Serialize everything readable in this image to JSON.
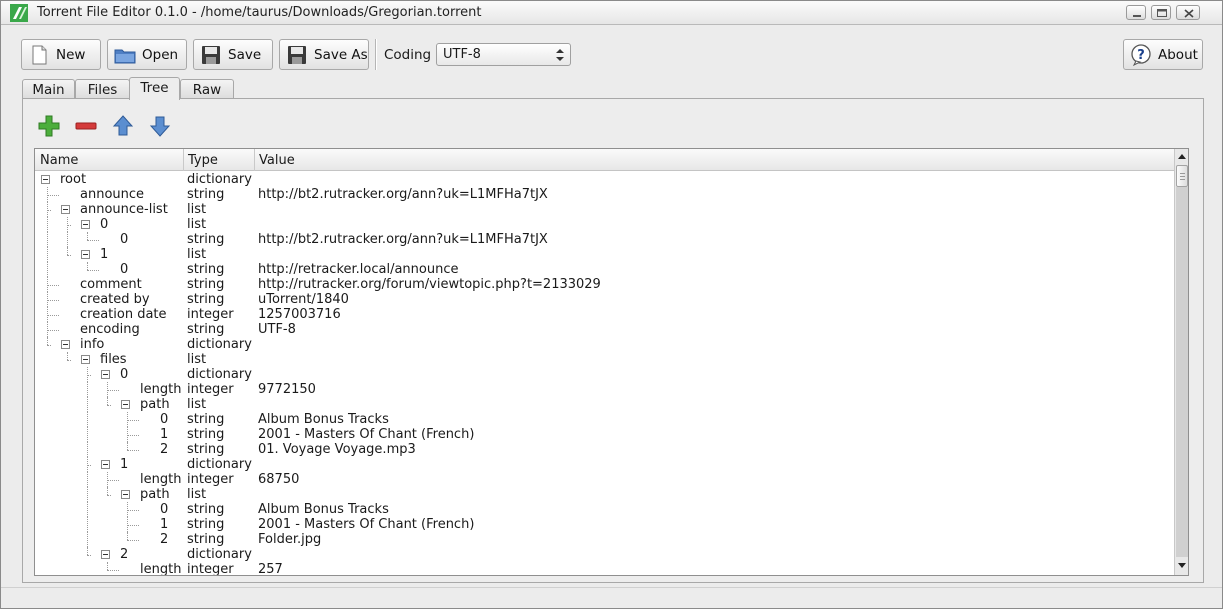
{
  "window": {
    "title": "Torrent File Editor 0.1.0 - /home/taurus/Downloads/Gregorian.torrent"
  },
  "toolbar": {
    "new_label": "New",
    "open_label": "Open",
    "save_label": "Save",
    "save_as_label": "Save As",
    "coding_label": "Coding",
    "coding_value": "UTF-8",
    "about_label": "About"
  },
  "tabs": [
    {
      "label": "Main"
    },
    {
      "label": "Files"
    },
    {
      "label": "Tree",
      "active": true
    },
    {
      "label": "Raw"
    }
  ],
  "tree_tools": [
    "add-icon",
    "remove-icon",
    "move-up-icon",
    "move-down-icon"
  ],
  "columns": [
    "Name",
    "Type",
    "Value"
  ],
  "rows": [
    {
      "depth": 0,
      "expander": true,
      "name": "root",
      "type": "dictionary",
      "value": ""
    },
    {
      "depth": 1,
      "expander": false,
      "name": "announce",
      "type": "string",
      "value": "http://bt2.rutracker.org/ann?uk=L1MFHa7tJX"
    },
    {
      "depth": 1,
      "expander": true,
      "name": "announce-list",
      "type": "list",
      "value": ""
    },
    {
      "depth": 2,
      "expander": true,
      "name": "0",
      "type": "list",
      "value": ""
    },
    {
      "depth": 3,
      "expander": false,
      "name": "0",
      "type": "string",
      "value": "http://bt2.rutracker.org/ann?uk=L1MFHa7tJX"
    },
    {
      "depth": 2,
      "expander": true,
      "name": "1",
      "type": "list",
      "value": ""
    },
    {
      "depth": 3,
      "expander": false,
      "name": "0",
      "type": "string",
      "value": "http://retracker.local/announce"
    },
    {
      "depth": 1,
      "expander": false,
      "name": "comment",
      "type": "string",
      "value": "http://rutracker.org/forum/viewtopic.php?t=2133029"
    },
    {
      "depth": 1,
      "expander": false,
      "name": "created by",
      "type": "string",
      "value": "uTorrent/1840"
    },
    {
      "depth": 1,
      "expander": false,
      "name": "creation date",
      "type": "integer",
      "value": "1257003716"
    },
    {
      "depth": 1,
      "expander": false,
      "name": "encoding",
      "type": "string",
      "value": "UTF-8"
    },
    {
      "depth": 1,
      "expander": true,
      "name": "info",
      "type": "dictionary",
      "value": ""
    },
    {
      "depth": 2,
      "expander": true,
      "name": "files",
      "type": "list",
      "value": ""
    },
    {
      "depth": 3,
      "expander": true,
      "name": "0",
      "type": "dictionary",
      "value": ""
    },
    {
      "depth": 4,
      "expander": false,
      "name": "length",
      "type": "integer",
      "value": "9772150"
    },
    {
      "depth": 4,
      "expander": true,
      "name": "path",
      "type": "list",
      "value": ""
    },
    {
      "depth": 5,
      "expander": false,
      "name": "0",
      "type": "string",
      "value": "Album Bonus Tracks"
    },
    {
      "depth": 5,
      "expander": false,
      "name": "1",
      "type": "string",
      "value": "2001 - Masters Of Chant (French)"
    },
    {
      "depth": 5,
      "expander": false,
      "name": "2",
      "type": "string",
      "value": "01. Voyage Voyage.mp3"
    },
    {
      "depth": 3,
      "expander": true,
      "name": "1",
      "type": "dictionary",
      "value": ""
    },
    {
      "depth": 4,
      "expander": false,
      "name": "length",
      "type": "integer",
      "value": "68750"
    },
    {
      "depth": 4,
      "expander": true,
      "name": "path",
      "type": "list",
      "value": ""
    },
    {
      "depth": 5,
      "expander": false,
      "name": "0",
      "type": "string",
      "value": "Album Bonus Tracks"
    },
    {
      "depth": 5,
      "expander": false,
      "name": "1",
      "type": "string",
      "value": "2001 - Masters Of Chant (French)"
    },
    {
      "depth": 5,
      "expander": false,
      "name": "2",
      "type": "string",
      "value": "Folder.jpg"
    },
    {
      "depth": 3,
      "expander": true,
      "name": "2",
      "type": "dictionary",
      "value": ""
    },
    {
      "depth": 4,
      "expander": false,
      "name": "length",
      "type": "integer",
      "value": "257"
    }
  ]
}
